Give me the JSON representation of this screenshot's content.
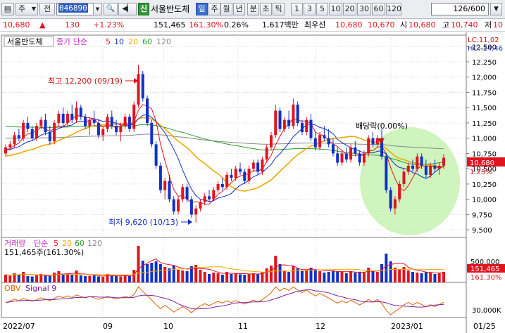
{
  "toolbar": {
    "menu_toggle": "▤",
    "market_select": "주",
    "jeon_btn": "전",
    "code": "046890",
    "search_icon": "🔍",
    "speaker": "◀▏",
    "sin_badge": "신",
    "stock_name": "서울반도체",
    "periods": [
      "일",
      "주",
      "월",
      "년",
      "분",
      "초",
      "틱"
    ],
    "active_period": "일",
    "intervals": [
      "1",
      "3",
      "5",
      "10",
      "20",
      "30",
      "60",
      "120"
    ],
    "page_display": "126/600"
  },
  "quote": {
    "price": "10,680",
    "arrow": "▲",
    "change": "130",
    "change_pct": "+1.23%",
    "volume": "151,465",
    "volume_ratio": "161.30%",
    "turnover": "0.26%",
    "amount": "1,617백만",
    "rank_label": "최우선",
    "best_ask": "10,680",
    "best_bid": "10,670",
    "open_label": "시",
    "open": "10,680",
    "high_label": "고",
    "high": "10,740",
    "low_label": "저",
    "low": "10"
  },
  "price_panel": {
    "legend_name": "서울반도체",
    "ma_label": "종가 단순",
    "ma_periods": [
      "5",
      "10",
      "20",
      "60",
      "120"
    ],
    "lc": "LC:11,02",
    "hc": "HC:-14,46",
    "max_label": "최고 12,200 (09/19)",
    "min_label": "최저 9,620 (10/13)",
    "dividend_label": "배당락(0.00%)",
    "current_tag": "10,680",
    "current_pct": "1.23%"
  },
  "volume_panel": {
    "label": "거래량",
    "ma_label": "단순",
    "ma_periods": [
      "5",
      "20",
      "60",
      "120"
    ],
    "value_text": "151,465주(161.30%)",
    "current_tag": "151,465",
    "current_pct": "161.30%"
  },
  "obv_panel": {
    "label": "OBV",
    "signal_label": "Signal 9"
  },
  "date_axis": [
    "2022/07",
    "09",
    "10",
    "11",
    "12",
    "2023/01",
    "01/25"
  ],
  "colors": {
    "up": "#e0141e",
    "down": "#1030c8",
    "ma5": "#e0141e",
    "ma10": "#1030c8",
    "ma20": "#f0a800",
    "ma60": "#2a9a2a",
    "ma120": "#888888",
    "obv": "#e06000",
    "signal": "#8020a0",
    "highlight": "#b8f0a0"
  },
  "chart_data": {
    "type": "candlestick",
    "price_ticks": [
      "12,500",
      "12,250",
      "12,000",
      "11,750",
      "11,500",
      "11,250",
      "11,000",
      "10,750",
      "10,500",
      "10,250",
      "10,000",
      "9,750",
      "9,500"
    ],
    "price_range": [
      9375,
      12687
    ],
    "volume_ticks": [
      "500,000"
    ],
    "obv_ticks": [
      "30,000K"
    ],
    "candles": [
      [
        10750,
        10900,
        10700,
        10850
      ],
      [
        10850,
        10950,
        10800,
        10900
      ],
      [
        10900,
        11100,
        10850,
        11050
      ],
      [
        11050,
        11150,
        10950,
        11000
      ],
      [
        11000,
        11300,
        10950,
        11250
      ],
      [
        11250,
        11350,
        11100,
        11150
      ],
      [
        11150,
        11200,
        10950,
        11000
      ],
      [
        11000,
        11250,
        10950,
        11200
      ],
      [
        11200,
        11350,
        11150,
        11300
      ],
      [
        11300,
        11400,
        11050,
        11100
      ],
      [
        11100,
        11200,
        10900,
        10950
      ],
      [
        10950,
        11300,
        10900,
        11250
      ],
      [
        11250,
        11450,
        11200,
        11400
      ],
      [
        11400,
        11500,
        11200,
        11250
      ],
      [
        11250,
        11450,
        11200,
        11400
      ],
      [
        11400,
        11550,
        11250,
        11300
      ],
      [
        11300,
        11600,
        11250,
        11500
      ],
      [
        11500,
        11550,
        11300,
        11350
      ],
      [
        11350,
        11400,
        11150,
        11200
      ],
      [
        11200,
        11350,
        11050,
        11300
      ],
      [
        11300,
        11450,
        11200,
        11250
      ],
      [
        11250,
        11300,
        11000,
        11050
      ],
      [
        11050,
        11200,
        10950,
        11150
      ],
      [
        11150,
        11400,
        11100,
        11350
      ],
      [
        11350,
        11450,
        11150,
        11200
      ],
      [
        11200,
        11300,
        11050,
        11100
      ],
      [
        11100,
        11250,
        10950,
        11200
      ],
      [
        11200,
        11400,
        11150,
        11350
      ],
      [
        11350,
        11400,
        11100,
        11150
      ],
      [
        11150,
        11600,
        11100,
        11550
      ],
      [
        11550,
        12200,
        11500,
        12050
      ],
      [
        12050,
        12100,
        11600,
        11650
      ],
      [
        11650,
        11700,
        11200,
        11250
      ],
      [
        11250,
        11300,
        10850,
        10900
      ],
      [
        10900,
        10950,
        10500,
        10550
      ],
      [
        10550,
        10600,
        10100,
        10150
      ],
      [
        10150,
        10350,
        10000,
        10300
      ],
      [
        10300,
        10400,
        9950,
        10000
      ],
      [
        10000,
        10050,
        9750,
        9800
      ],
      [
        9800,
        10050,
        9750,
        10000
      ],
      [
        10000,
        10250,
        9950,
        10200
      ],
      [
        10200,
        10250,
        9950,
        10000
      ],
      [
        10000,
        10050,
        9700,
        9750
      ],
      [
        9750,
        9900,
        9620,
        9850
      ],
      [
        9850,
        10000,
        9800,
        9950
      ],
      [
        9950,
        10100,
        9900,
        10050
      ],
      [
        10050,
        10150,
        9950,
        10000
      ],
      [
        10000,
        10200,
        9980,
        10150
      ],
      [
        10150,
        10300,
        10100,
        10250
      ],
      [
        10250,
        10350,
        10150,
        10200
      ],
      [
        10200,
        10450,
        10150,
        10400
      ],
      [
        10400,
        10500,
        10300,
        10350
      ],
      [
        10350,
        10550,
        10300,
        10500
      ],
      [
        10500,
        10600,
        10400,
        10450
      ],
      [
        10450,
        10500,
        10250,
        10300
      ],
      [
        10300,
        10550,
        10250,
        10500
      ],
      [
        10500,
        10650,
        10450,
        10600
      ],
      [
        10600,
        10650,
        10400,
        10450
      ],
      [
        10450,
        10700,
        10400,
        10650
      ],
      [
        10650,
        10900,
        10600,
        10850
      ],
      [
        10850,
        11100,
        10800,
        11050
      ],
      [
        11050,
        11550,
        11000,
        11450
      ],
      [
        11450,
        11500,
        11100,
        11150
      ],
      [
        11150,
        11350,
        11100,
        11300
      ],
      [
        11300,
        11450,
        11150,
        11200
      ],
      [
        11200,
        11650,
        11150,
        11550
      ],
      [
        11550,
        11600,
        11200,
        11250
      ],
      [
        11250,
        11300,
        11050,
        11100
      ],
      [
        11100,
        11350,
        11050,
        11300
      ],
      [
        11300,
        11400,
        10950,
        11000
      ],
      [
        11000,
        11100,
        10800,
        10850
      ],
      [
        10850,
        11100,
        10800,
        11050
      ],
      [
        11050,
        11200,
        10950,
        11000
      ],
      [
        11000,
        11150,
        10850,
        10900
      ],
      [
        10900,
        11000,
        10700,
        10750
      ],
      [
        10750,
        10850,
        10550,
        10600
      ],
      [
        10600,
        10800,
        10550,
        10750
      ],
      [
        10750,
        10850,
        10600,
        10650
      ],
      [
        10650,
        10900,
        10600,
        10850
      ],
      [
        10850,
        10950,
        10700,
        10750
      ],
      [
        10750,
        10800,
        10550,
        10600
      ],
      [
        10600,
        10800,
        10550,
        10750
      ],
      [
        10750,
        11050,
        10700,
        11000
      ],
      [
        11000,
        11100,
        10850,
        10900
      ],
      [
        10900,
        11050,
        10850,
        11000
      ],
      [
        11000,
        11150,
        10650,
        10700
      ],
      [
        10700,
        10750,
        10100,
        10150
      ],
      [
        10150,
        10200,
        9800,
        9850
      ],
      [
        9850,
        10050,
        9750,
        10000
      ],
      [
        10000,
        10300,
        9950,
        10250
      ],
      [
        10250,
        10500,
        10200,
        10450
      ],
      [
        10450,
        10600,
        10400,
        10550
      ],
      [
        10550,
        10650,
        10450,
        10500
      ],
      [
        10500,
        10750,
        10450,
        10700
      ],
      [
        10700,
        10750,
        10500,
        10550
      ],
      [
        10550,
        10650,
        10350,
        10400
      ],
      [
        10400,
        10600,
        10350,
        10550
      ],
      [
        10550,
        10650,
        10450,
        10500
      ],
      [
        10500,
        10600,
        10400,
        10550
      ],
      [
        10550,
        10740,
        10500,
        10680
      ]
    ],
    "volumes": [
      110000,
      95000,
      130000,
      105000,
      150000,
      90000,
      85000,
      100000,
      120000,
      95000,
      90000,
      140000,
      160000,
      110000,
      120000,
      115000,
      170000,
      100000,
      90000,
      95000,
      100000,
      85000,
      80000,
      120000,
      95000,
      90000,
      85000,
      100000,
      90000,
      180000,
      520000,
      310000,
      260000,
      280000,
      300000,
      260000,
      220000,
      200000,
      240000,
      180000,
      170000,
      160000,
      230000,
      250000,
      180000,
      150000,
      120000,
      140000,
      130000,
      110000,
      150000,
      120000,
      130000,
      115000,
      110000,
      125000,
      130000,
      115000,
      150000,
      200000,
      240000,
      380000,
      260000,
      170000,
      150000,
      230000,
      200000,
      160000,
      170000,
      210000,
      180000,
      160000,
      140000,
      150000,
      170000,
      160000,
      150000,
      130000,
      160000,
      140000,
      150000,
      140000,
      210000,
      160000,
      150000,
      260000,
      410000,
      300000,
      210000,
      190000,
      220000,
      170000,
      150000,
      140000,
      130000,
      150000,
      140000,
      120000,
      130000,
      151465
    ]
  }
}
